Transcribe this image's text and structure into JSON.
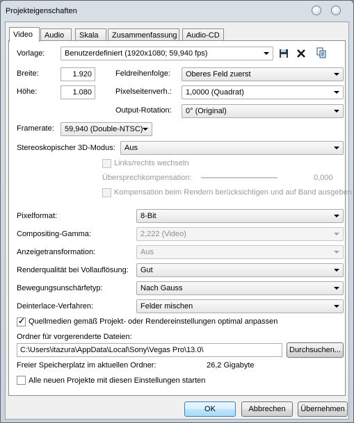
{
  "window": {
    "title": "Projekteigenschaften"
  },
  "tabs": [
    {
      "label": "Video"
    },
    {
      "label": "Audio"
    },
    {
      "label": "Skala"
    },
    {
      "label": "Zusammenfassung"
    },
    {
      "label": "Audio-CD"
    }
  ],
  "video": {
    "template_label": "Vorlage:",
    "template_value": "Benutzerdefiniert (1920x1080; 59,940 fps)",
    "width_label": "Breite:",
    "width_value": "1.920",
    "height_label": "Höhe:",
    "height_value": "1.080",
    "field_order_label": "Feldreihenfolge:",
    "field_order_value": "Oberes Feld zuerst",
    "pixel_aspect_label": "Pixelseitenverh.:",
    "pixel_aspect_value": "1,0000 (Quadrat)",
    "output_rotation_label": "Output-Rotation:",
    "output_rotation_value": "0° (Original)",
    "framerate_label": "Framerate:",
    "framerate_value": "59,940 (Double-NTSC)",
    "stereo_label": "Stereoskopischer 3D-Modus:",
    "stereo_value": "Aus",
    "swap_lr_label": "Links/rechts wechseln",
    "crosstalk_label": "Übersprechkompensation:",
    "crosstalk_value": "0,000",
    "compensation_label": "Kompensation beim Rendern berücksichtigen und auf Band ausgeben",
    "pixel_format_label": "Pixelformat:",
    "pixel_format_value": "8-Bit",
    "compositing_gamma_label": "Compositing-Gamma:",
    "compositing_gamma_value": "2,222 (Video)",
    "view_transform_label": "Anzeigetransformation:",
    "view_transform_value": "Aus",
    "render_quality_label": "Renderqualität bei Vollauflösung:",
    "render_quality_value": "Gut",
    "motion_blur_label": "Bewegungsunschärfetyp:",
    "motion_blur_value": "Nach Gauss",
    "deinterlace_label": "Deinterlace-Verfahren:",
    "deinterlace_value": "Felder mischen",
    "adapt_source_label": "Quellmedien gemäß Projekt- oder Rendereinstellungen optimal anpassen",
    "prerender_folder_label": "Ordner für vorgerenderte Dateien:",
    "prerender_folder_value": "C:\\Users\\itazura\\AppData\\Local\\Sony\\Vegas Pro\\13.0\\",
    "browse_label": "Durchsuchen...",
    "free_space_label": "Freier Speicherplatz im aktuellen Ordner:",
    "free_space_value": "26,2 Gigabyte",
    "start_all_label": "Alle neuen Projekte mit diesen Einstellungen starten"
  },
  "state": {
    "swap_lr_checked": false,
    "compensation_checked": false,
    "adapt_source_checked": true,
    "start_all_checked": false
  },
  "buttons": {
    "ok": "OK",
    "cancel": "Abbrechen",
    "apply": "Übernehmen"
  },
  "icons": [
    "save-icon",
    "delete-icon",
    "copy-icon",
    "minimize-icon",
    "close-icon"
  ],
  "colors": {
    "default_button": "#bee6fd",
    "delete_icon": "#1a1a1a"
  }
}
